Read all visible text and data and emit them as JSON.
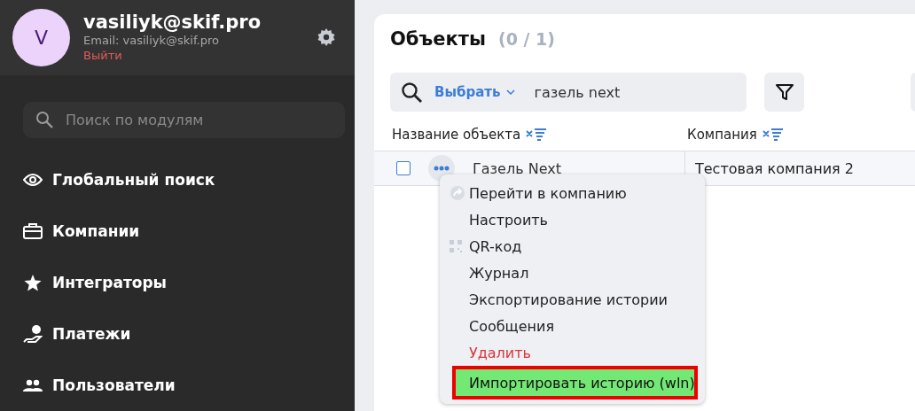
{
  "profile": {
    "avatar_letter": "V",
    "name": "vasiliyk@skif.pro",
    "email": "Email: vasiliyk@skif.pro",
    "logout": "Выйти"
  },
  "module_search": {
    "placeholder": "Поиск по модулям"
  },
  "nav": [
    {
      "label": "Глобальный поиск",
      "kind": "eye"
    },
    {
      "label": "Компании",
      "kind": "briefcase"
    },
    {
      "label": "Интеграторы",
      "kind": "star"
    },
    {
      "label": "Платежи",
      "kind": "payment"
    },
    {
      "label": "Пользователи",
      "kind": "users"
    }
  ],
  "page": {
    "title": "Объекты",
    "count": "(0 / 1)"
  },
  "search": {
    "selector": "Выбрать",
    "value": "газель next"
  },
  "table": {
    "columns": [
      "Название объекта",
      "Компания"
    ],
    "rows": [
      {
        "checked": false,
        "cells": [
          "Газель Next",
          "Тестовая компания 2"
        ]
      }
    ]
  },
  "context_menu": [
    {
      "label": "Перейти в компанию",
      "kind": "link",
      "selected": false
    },
    {
      "label": "Настроить",
      "kind": "plain",
      "selected": false
    },
    {
      "label": "QR-код",
      "kind": "qr",
      "selected": false
    },
    {
      "label": "Журнал",
      "kind": "plain",
      "selected": false
    },
    {
      "label": "Экспортирование истории",
      "kind": "plain",
      "selected": false
    },
    {
      "label": "Сообщения",
      "kind": "plain",
      "selected": false
    },
    {
      "label": "Удалить",
      "kind": "danger",
      "selected": false
    },
    {
      "label": "Импортировать историю (wln)",
      "kind": "plain",
      "selected": true
    }
  ]
}
